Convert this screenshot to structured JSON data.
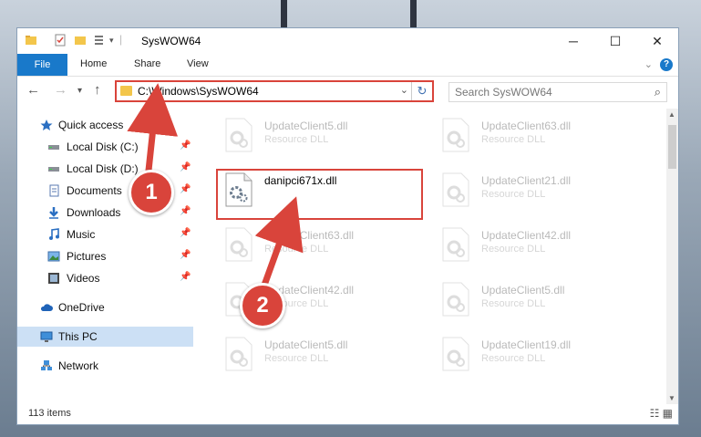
{
  "window": {
    "title": "SysWOW64"
  },
  "ribbon": {
    "tabs": [
      "File",
      "Home",
      "Share",
      "View"
    ],
    "help": "?"
  },
  "address": {
    "path": "C:\\Windows\\SysWOW64"
  },
  "search": {
    "placeholder": "Search SysWOW64"
  },
  "nav": {
    "items": [
      {
        "label": "Quick access",
        "icon": "star-icon"
      },
      {
        "label": "Local Disk (C:)",
        "icon": "drive-icon",
        "pinned": true
      },
      {
        "label": "Local Disk (D:)",
        "icon": "drive-icon",
        "pinned": true
      },
      {
        "label": "Documents",
        "icon": "documents-icon",
        "pinned": true
      },
      {
        "label": "Downloads",
        "icon": "downloads-icon",
        "pinned": true
      },
      {
        "label": "Music",
        "icon": "music-icon",
        "pinned": true
      },
      {
        "label": "Pictures",
        "icon": "pictures-icon",
        "pinned": true
      },
      {
        "label": "Videos",
        "icon": "videos-icon",
        "pinned": true
      },
      {
        "label": "OneDrive",
        "icon": "cloud-icon"
      },
      {
        "label": "This PC",
        "icon": "computer-icon",
        "selected": true
      },
      {
        "label": "Network",
        "icon": "network-icon"
      }
    ]
  },
  "files": {
    "col1": [
      {
        "name": "UpdateClient5.dll",
        "type": "Resource DLL"
      },
      {
        "name": "danipci671x.dll",
        "type": ""
      },
      {
        "name": "UpdateClient63.dll",
        "type": "Resource DLL"
      },
      {
        "name": "UpdateClient42.dll",
        "type": "Resource DLL"
      },
      {
        "name": "UpdateClient5.dll",
        "type": "Resource DLL"
      }
    ],
    "col2": [
      {
        "name": "UpdateClient63.dll",
        "type": "Resource DLL"
      },
      {
        "name": "UpdateClient21.dll",
        "type": "Resource DLL"
      },
      {
        "name": "UpdateClient42.dll",
        "type": "Resource DLL"
      },
      {
        "name": "UpdateClient5.dll",
        "type": "Resource DLL"
      },
      {
        "name": "UpdateClient19.dll",
        "type": "Resource DLL"
      }
    ]
  },
  "status": {
    "count": "113 items"
  },
  "callouts": {
    "one": "1",
    "two": "2"
  },
  "colors": {
    "accent": "#1979ca",
    "highlight": "#d9443b"
  }
}
